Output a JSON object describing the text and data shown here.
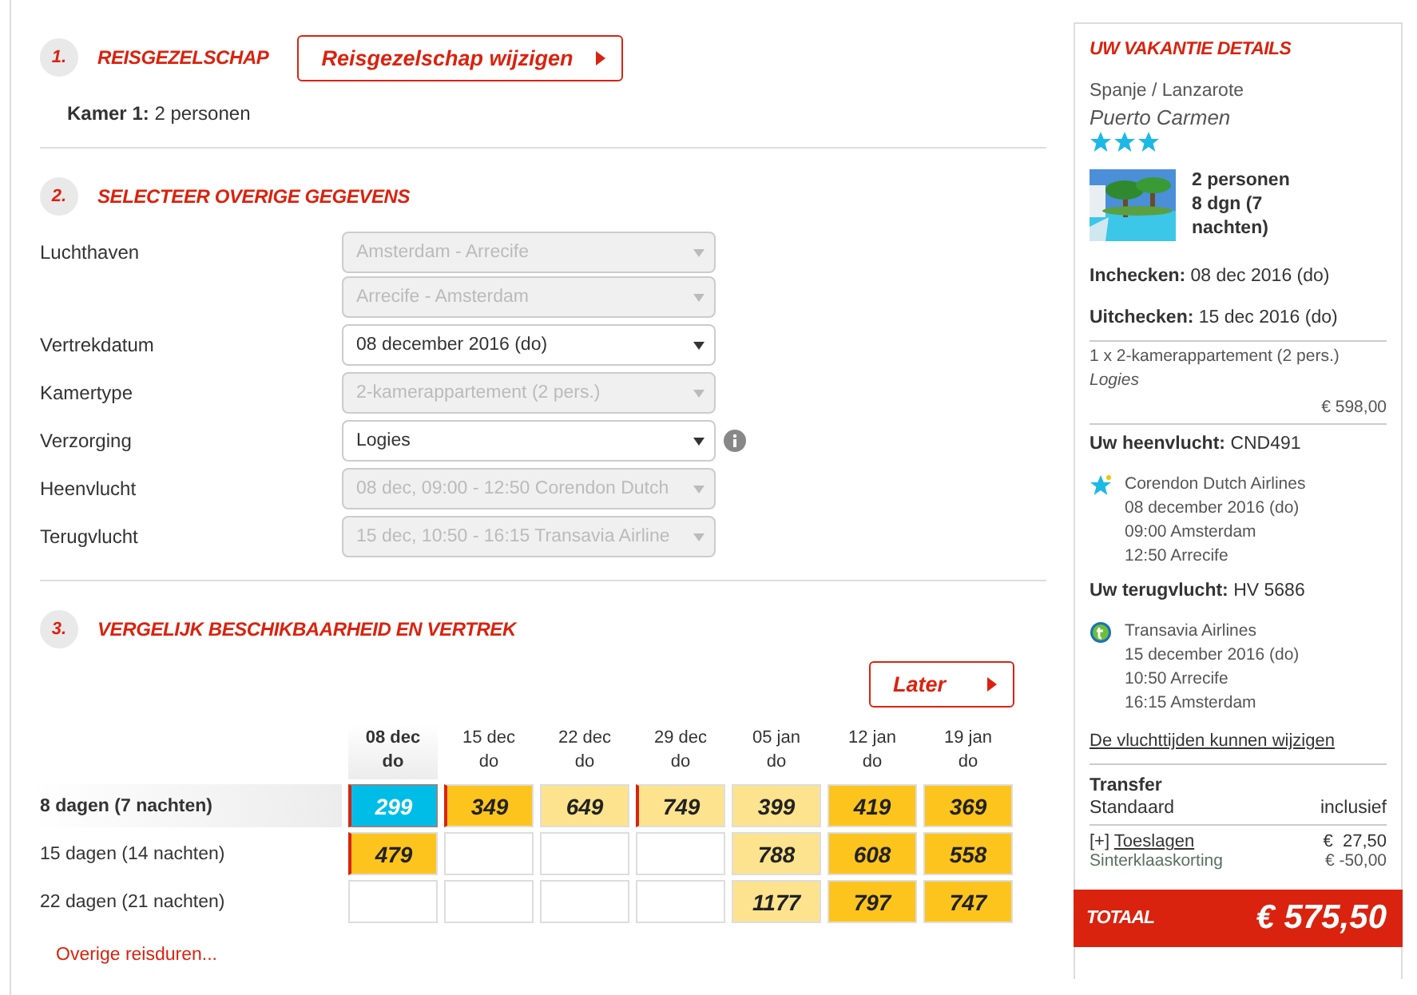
{
  "step1": {
    "number": "1.",
    "title": "REISGEZELSCHAP",
    "button": "Reisgezelschap wijzigen",
    "room_label": "Kamer 1:",
    "room_value": "2 personen"
  },
  "step2": {
    "number": "2.",
    "title": "SELECTEER OVERIGE GEGEVENS",
    "fields": [
      {
        "label": "Luchthaven",
        "info": false,
        "selects": [
          {
            "value": "Amsterdam - Arrecife",
            "disabled": true
          },
          {
            "value": "Arrecife - Amsterdam",
            "disabled": true
          }
        ]
      },
      {
        "label": "Vertrekdatum",
        "info": false,
        "selects": [
          {
            "value": "08 december 2016 (do)",
            "disabled": false
          }
        ]
      },
      {
        "label": "Kamertype",
        "info": false,
        "selects": [
          {
            "value": "2-kamerappartement (2 pers.)",
            "disabled": true
          }
        ]
      },
      {
        "label": "Verzorging",
        "info": true,
        "selects": [
          {
            "value": "Logies",
            "disabled": false
          }
        ]
      },
      {
        "label": "Heenvlucht",
        "info": false,
        "selects": [
          {
            "value": "08 dec, 09:00 - 12:50 Corendon Dutch",
            "disabled": true
          }
        ]
      },
      {
        "label": "Terugvlucht",
        "info": false,
        "selects": [
          {
            "value": "15 dec, 10:50 - 16:15 Transavia Airline",
            "disabled": true
          }
        ]
      }
    ]
  },
  "step3": {
    "number": "3.",
    "title": "VERGELIJK BESCHIKBAARHEID EN VERTREK",
    "later_button": "Later",
    "columns": [
      {
        "date": "08 dec",
        "day": "do",
        "selected": true
      },
      {
        "date": "15 dec",
        "day": "do",
        "selected": false
      },
      {
        "date": "22 dec",
        "day": "do",
        "selected": false
      },
      {
        "date": "29 dec",
        "day": "do",
        "selected": false
      },
      {
        "date": "05 jan",
        "day": "do",
        "selected": false
      },
      {
        "date": "12 jan",
        "day": "do",
        "selected": false
      },
      {
        "date": "19 jan",
        "day": "do",
        "selected": false
      }
    ],
    "rows": [
      {
        "label": "8 dagen (7 nachten)",
        "selected": true,
        "cells": [
          {
            "price": "299",
            "kind": "selected",
            "marked": true
          },
          {
            "price": "349",
            "kind": "dark",
            "marked": true
          },
          {
            "price": "649",
            "kind": "light",
            "marked": false
          },
          {
            "price": "749",
            "kind": "light",
            "marked": true
          },
          {
            "price": "399",
            "kind": "light",
            "marked": false
          },
          {
            "price": "419",
            "kind": "dark",
            "marked": false
          },
          {
            "price": "369",
            "kind": "dark",
            "marked": false
          }
        ]
      },
      {
        "label": "15 dagen (14 nachten)",
        "selected": false,
        "cells": [
          {
            "price": "479",
            "kind": "dark",
            "marked": true
          },
          {
            "kind": "empty",
            "marked": false
          },
          {
            "kind": "empty",
            "marked": false
          },
          {
            "kind": "empty",
            "marked": false
          },
          {
            "price": "788",
            "kind": "light",
            "marked": false
          },
          {
            "price": "608",
            "kind": "dark",
            "marked": false
          },
          {
            "price": "558",
            "kind": "dark",
            "marked": false
          }
        ]
      },
      {
        "label": "22 dagen (21 nachten)",
        "selected": false,
        "cells": [
          {
            "kind": "empty",
            "marked": false
          },
          {
            "kind": "empty",
            "marked": false
          },
          {
            "kind": "empty",
            "marked": false
          },
          {
            "kind": "empty",
            "marked": false
          },
          {
            "price": "1177",
            "kind": "light",
            "marked": false
          },
          {
            "price": "797",
            "kind": "dark",
            "marked": false
          },
          {
            "price": "747",
            "kind": "dark",
            "marked": false
          }
        ]
      }
    ],
    "more_link": "Overige reisduren..."
  },
  "sidebar": {
    "title": "UW VAKANTIE DETAILS",
    "region": "Spanje / Lanzarote",
    "hotel": "Puerto Carmen",
    "stars": 3,
    "persons": "2 personen",
    "duration": "8 dgn (7 nachten)",
    "checkin_label": "Inchecken:",
    "checkin_value": "08 dec 2016 (do)",
    "checkout_label": "Uitchecken:",
    "checkout_value": "15 dec 2016 (do)",
    "room_line": "1 x 2-kamerappartement (2 pers.)",
    "board": "Logies",
    "room_price": "€ 598,00",
    "flights": [
      {
        "label": "Uw heenvlucht:",
        "code": "CND491",
        "kind": "star",
        "airline": "Corendon Dutch Airlines",
        "date": "08 december 2016 (do)",
        "departure": "09:00 Amsterdam",
        "arrival": "12:50 Arrecife"
      },
      {
        "label": "Uw terugvlucht:",
        "code": "HV 5686",
        "kind": "circle",
        "airline": "Transavia Airlines",
        "date": "15 december 2016 (do)",
        "departure": "10:50 Arrecife",
        "arrival": "16:15 Amsterdam"
      }
    ],
    "change_link": "De vluchttijden kunnen wijzigen",
    "transfer_title": "Transfer",
    "transfer_name": "Standaard",
    "transfer_value": "inclusief",
    "surcharge_prefix": "[+]",
    "surcharge_link": "Toeslagen",
    "surcharge_amount": "€  27,50",
    "discount_label": "Sinterklaaskorting",
    "discount_amount": "€ -50,00",
    "total_label": "TOTAAL",
    "total_value": "€ 575,50"
  }
}
